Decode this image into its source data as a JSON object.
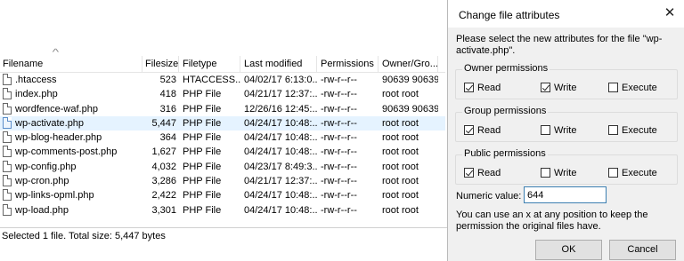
{
  "file_list": {
    "columns": [
      "Filename",
      "Filesize",
      "Filetype",
      "Last modified",
      "Permissions",
      "Owner/Gro..."
    ],
    "rows": [
      {
        "name": ".htaccess",
        "size": "523",
        "type": "HTACCESS...",
        "modified": "04/02/17 6:13:0...",
        "perms": "-rw-r--r--",
        "owner": "90639 90639",
        "selected": false
      },
      {
        "name": "index.php",
        "size": "418",
        "type": "PHP File",
        "modified": "04/21/17 12:37:...",
        "perms": "-rw-r--r--",
        "owner": "root root",
        "selected": false
      },
      {
        "name": "wordfence-waf.php",
        "size": "316",
        "type": "PHP File",
        "modified": "12/26/16 12:45:...",
        "perms": "-rw-r--r--",
        "owner": "90639 90639",
        "selected": false
      },
      {
        "name": "wp-activate.php",
        "size": "5,447",
        "type": "PHP File",
        "modified": "04/24/17 10:48:...",
        "perms": "-rw-r--r--",
        "owner": "root root",
        "selected": true
      },
      {
        "name": "wp-blog-header.php",
        "size": "364",
        "type": "PHP File",
        "modified": "04/24/17 10:48:...",
        "perms": "-rw-r--r--",
        "owner": "root root",
        "selected": false
      },
      {
        "name": "wp-comments-post.php",
        "size": "1,627",
        "type": "PHP File",
        "modified": "04/24/17 10:48:...",
        "perms": "-rw-r--r--",
        "owner": "root root",
        "selected": false
      },
      {
        "name": "wp-config.php",
        "size": "4,032",
        "type": "PHP File",
        "modified": "04/23/17 8:49:3...",
        "perms": "-rw-r--r--",
        "owner": "root root",
        "selected": false
      },
      {
        "name": "wp-cron.php",
        "size": "3,286",
        "type": "PHP File",
        "modified": "04/21/17 12:37:...",
        "perms": "-rw-r--r--",
        "owner": "root root",
        "selected": false
      },
      {
        "name": "wp-links-opml.php",
        "size": "2,422",
        "type": "PHP File",
        "modified": "04/24/17 10:48:...",
        "perms": "-rw-r--r--",
        "owner": "root root",
        "selected": false
      },
      {
        "name": "wp-load.php",
        "size": "3,301",
        "type": "PHP File",
        "modified": "04/24/17 10:48:...",
        "perms": "-rw-r--r--",
        "owner": "root root",
        "selected": false
      }
    ],
    "status": "Selected 1 file. Total size: 5,447 bytes"
  },
  "dialog": {
    "title": "Change file attributes",
    "close_icon": "close-icon",
    "description": "Please select the new attributes for the file \"wp-activate.php\".",
    "groups": [
      {
        "label": "Owner permissions",
        "read": true,
        "write": true,
        "execute": false
      },
      {
        "label": "Group permissions",
        "read": true,
        "write": false,
        "execute": false
      },
      {
        "label": "Public permissions",
        "read": true,
        "write": false,
        "execute": false
      }
    ],
    "checkbox_labels": {
      "read": "Read",
      "write": "Write",
      "execute": "Execute"
    },
    "numeric_label": "Numeric value:",
    "numeric_value": "644",
    "hint": "You can use an x at any position to keep the permission the original files have.",
    "ok_label": "OK",
    "cancel_label": "Cancel"
  }
}
